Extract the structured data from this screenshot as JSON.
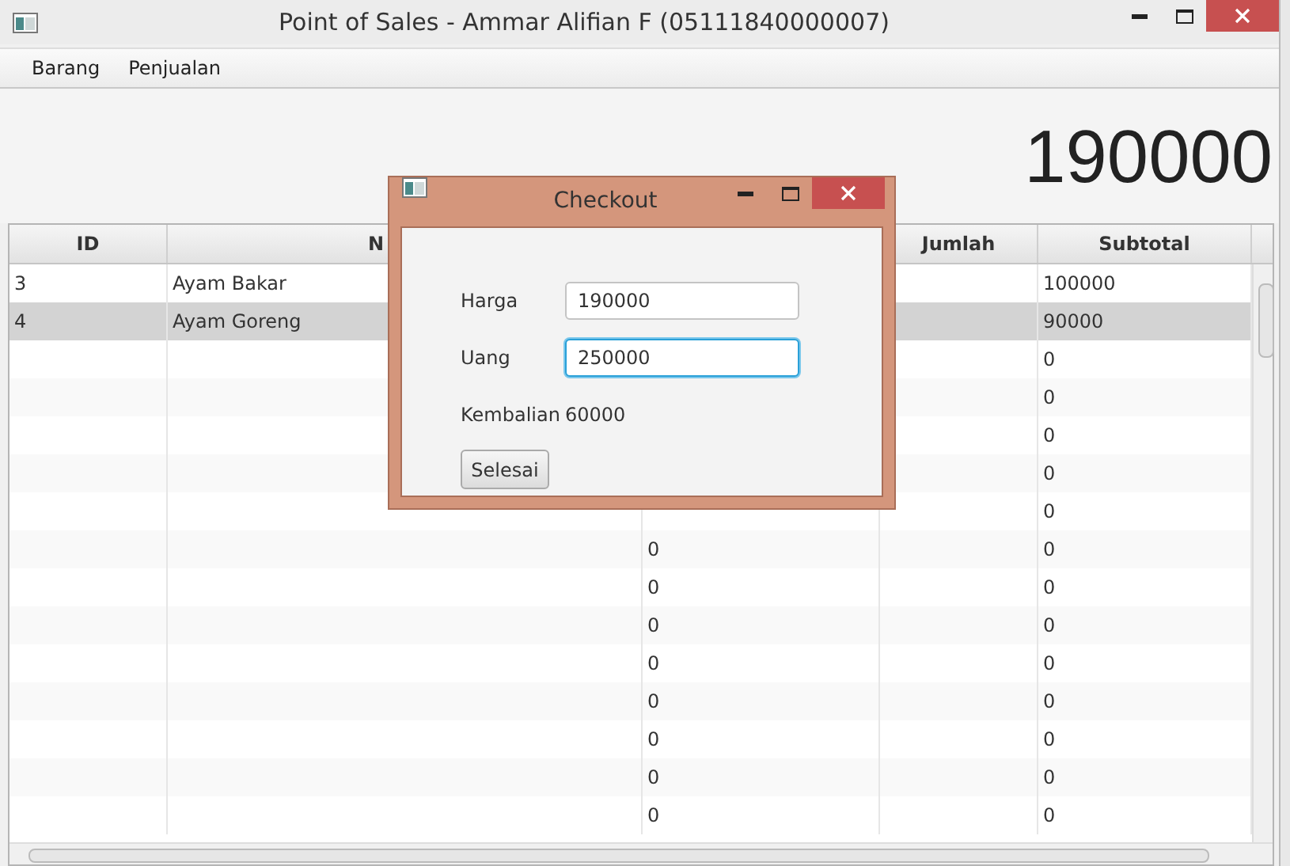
{
  "window": {
    "title": "Point of Sales - Ammar Alifian F (05111840000007)"
  },
  "menu": [
    {
      "label": "Barang"
    },
    {
      "label": "Penjualan"
    }
  ],
  "total": "190000",
  "table": {
    "columns": [
      "ID",
      "N",
      null,
      "Jumlah",
      "Subtotal"
    ],
    "rows": [
      {
        "selected": false,
        "cells": [
          "3",
          "Ayam Bakar",
          null,
          null,
          "100000"
        ]
      },
      {
        "selected": true,
        "cells": [
          "4",
          "Ayam Goreng",
          null,
          null,
          "90000"
        ]
      },
      {
        "selected": false,
        "cells": [
          null,
          null,
          null,
          null,
          "0"
        ]
      },
      {
        "selected": false,
        "cells": [
          null,
          null,
          null,
          null,
          "0"
        ]
      },
      {
        "selected": false,
        "cells": [
          null,
          null,
          null,
          null,
          "0"
        ]
      },
      {
        "selected": false,
        "cells": [
          null,
          null,
          null,
          null,
          "0"
        ]
      },
      {
        "selected": false,
        "cells": [
          null,
          null,
          null,
          null,
          "0"
        ]
      },
      {
        "selected": false,
        "cells": [
          null,
          null,
          "0",
          null,
          "0"
        ]
      },
      {
        "selected": false,
        "cells": [
          null,
          null,
          "0",
          null,
          "0"
        ]
      },
      {
        "selected": false,
        "cells": [
          null,
          null,
          "0",
          null,
          "0"
        ]
      },
      {
        "selected": false,
        "cells": [
          null,
          null,
          "0",
          null,
          "0"
        ]
      },
      {
        "selected": false,
        "cells": [
          null,
          null,
          "0",
          null,
          "0"
        ]
      },
      {
        "selected": false,
        "cells": [
          null,
          null,
          "0",
          null,
          "0"
        ]
      },
      {
        "selected": false,
        "cells": [
          null,
          null,
          "0",
          null,
          "0"
        ]
      },
      {
        "selected": false,
        "cells": [
          null,
          null,
          "0",
          null,
          "0"
        ]
      }
    ]
  },
  "dialog": {
    "title": "Checkout",
    "fields": [
      {
        "label": "Harga",
        "value": "190000",
        "focused": false
      },
      {
        "label": "Uang",
        "value": "250000",
        "focused": true
      }
    ],
    "result": {
      "label": "Kembalian",
      "value": "60000"
    },
    "button": "Selesai"
  }
}
